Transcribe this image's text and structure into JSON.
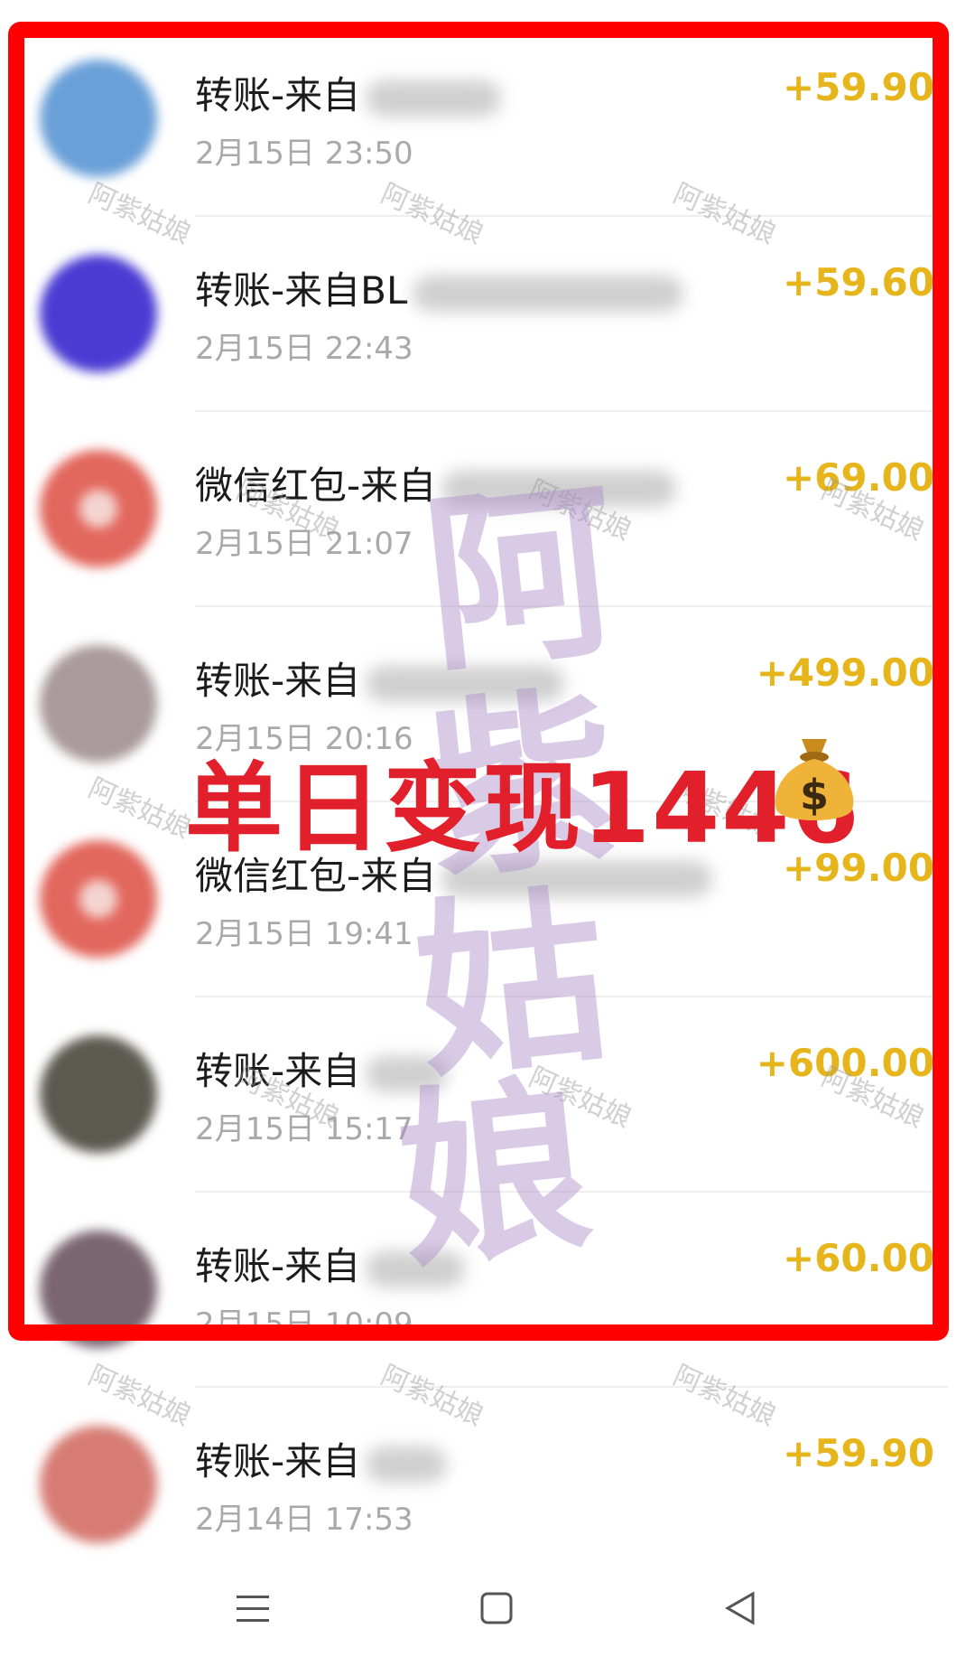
{
  "transactions": [
    {
      "title": "转账-来自",
      "time": "2月15日 23:50",
      "amount": "+59.90",
      "avatar_color": "#6aa0d8"
    },
    {
      "title": "转账-来自BL",
      "time": "2月15日 22:43",
      "amount": "+59.60",
      "avatar_color": "#4b3bd3"
    },
    {
      "title": "微信红包-来自",
      "time": "2月15日 21:07",
      "amount": "+69.00",
      "avatar_color": "#e2675d"
    },
    {
      "title": "转账-来自",
      "time": "2月15日 20:16",
      "amount": "+499.00",
      "avatar_color": "#a99a9c"
    },
    {
      "title": "微信红包-来自",
      "time": "2月15日 19:41",
      "amount": "+99.00",
      "avatar_color": "#e2675d"
    },
    {
      "title": "转账-来自",
      "time": "2月15日 15:17",
      "amount": "+600.00",
      "avatar_color": "#5c5a50"
    },
    {
      "title": "转账-来自",
      "time": "2月15日 10:09",
      "amount": "+60.00",
      "avatar_color": "#7a6570"
    },
    {
      "title": "转账-来自",
      "time": "2月14日 17:53",
      "amount": "+59.90",
      "avatar_color": "#d77c74"
    }
  ],
  "overlay": {
    "headline": "单日变现1446",
    "moneybag_icon": "money-bag-icon",
    "big_watermark_chars": [
      "阿",
      "紫",
      "姑",
      "娘"
    ],
    "small_watermark": "阿紫姑娘"
  },
  "colors": {
    "amount": "#e6b51c",
    "frame": "#ff0000",
    "headline": "#e2202b"
  },
  "navbar": {
    "icons": [
      "menu-icon",
      "home-square-icon",
      "back-triangle-icon"
    ]
  }
}
